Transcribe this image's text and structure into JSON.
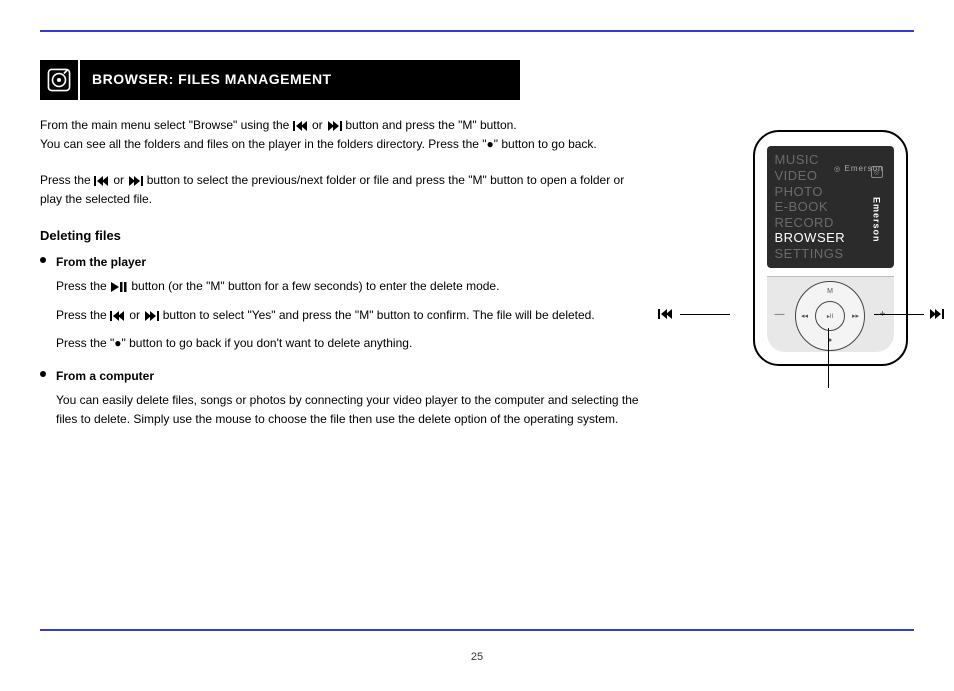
{
  "page_number": "25",
  "section": {
    "title": "BROWSER: FILES MANAGEMENT"
  },
  "text": {
    "intro1_a": "From the main menu select \"Browse\" using the ",
    "intro1_b": " or ",
    "intro1_c": " button and press the \"M\" button.",
    "intro2": "You can see all the folders and files on the player in the folders directory. Press the \"●\" button to go back.",
    "p2_a": "Press the ",
    "p2_b": " or ",
    "p2_c": " button to select the previous/next folder or file and press the  \"M\" button to open a folder or play the selected file.",
    "deleting_head": "Deleting files",
    "from_player": "From the player",
    "fp1_a": "Press the ",
    "fp1_b": " button (or the \"M\" button for a few seconds) to enter the delete mode.",
    "fp2_a": "Press the ",
    "fp2_b": " or ",
    "fp2_c": " button to select \"Yes\" and press the \"M\" button to confirm. The file will be deleted.",
    "fp3": "Press the \"●\" button to go back if you don't want to delete anything.",
    "from_pc": "From a computer",
    "pc_body": "You can easily delete files, songs or photos by connecting your video player to the computer and selecting the files to delete. Simply use the mouse to choose the file then use the delete option of the operating  system."
  },
  "device": {
    "brand": "Emerson",
    "menu": [
      "MUSIC",
      "VIDEO",
      "PHOTO",
      "E-BOOK",
      "RECORD",
      "BROWSER",
      "SETTINGS"
    ],
    "selected_index": 5,
    "callouts": {
      "play": "",
      "prev": "",
      "next": ""
    }
  },
  "icons": {
    "prev": "prev-icon",
    "next": "next-icon",
    "playpause": "play-pause-icon"
  }
}
